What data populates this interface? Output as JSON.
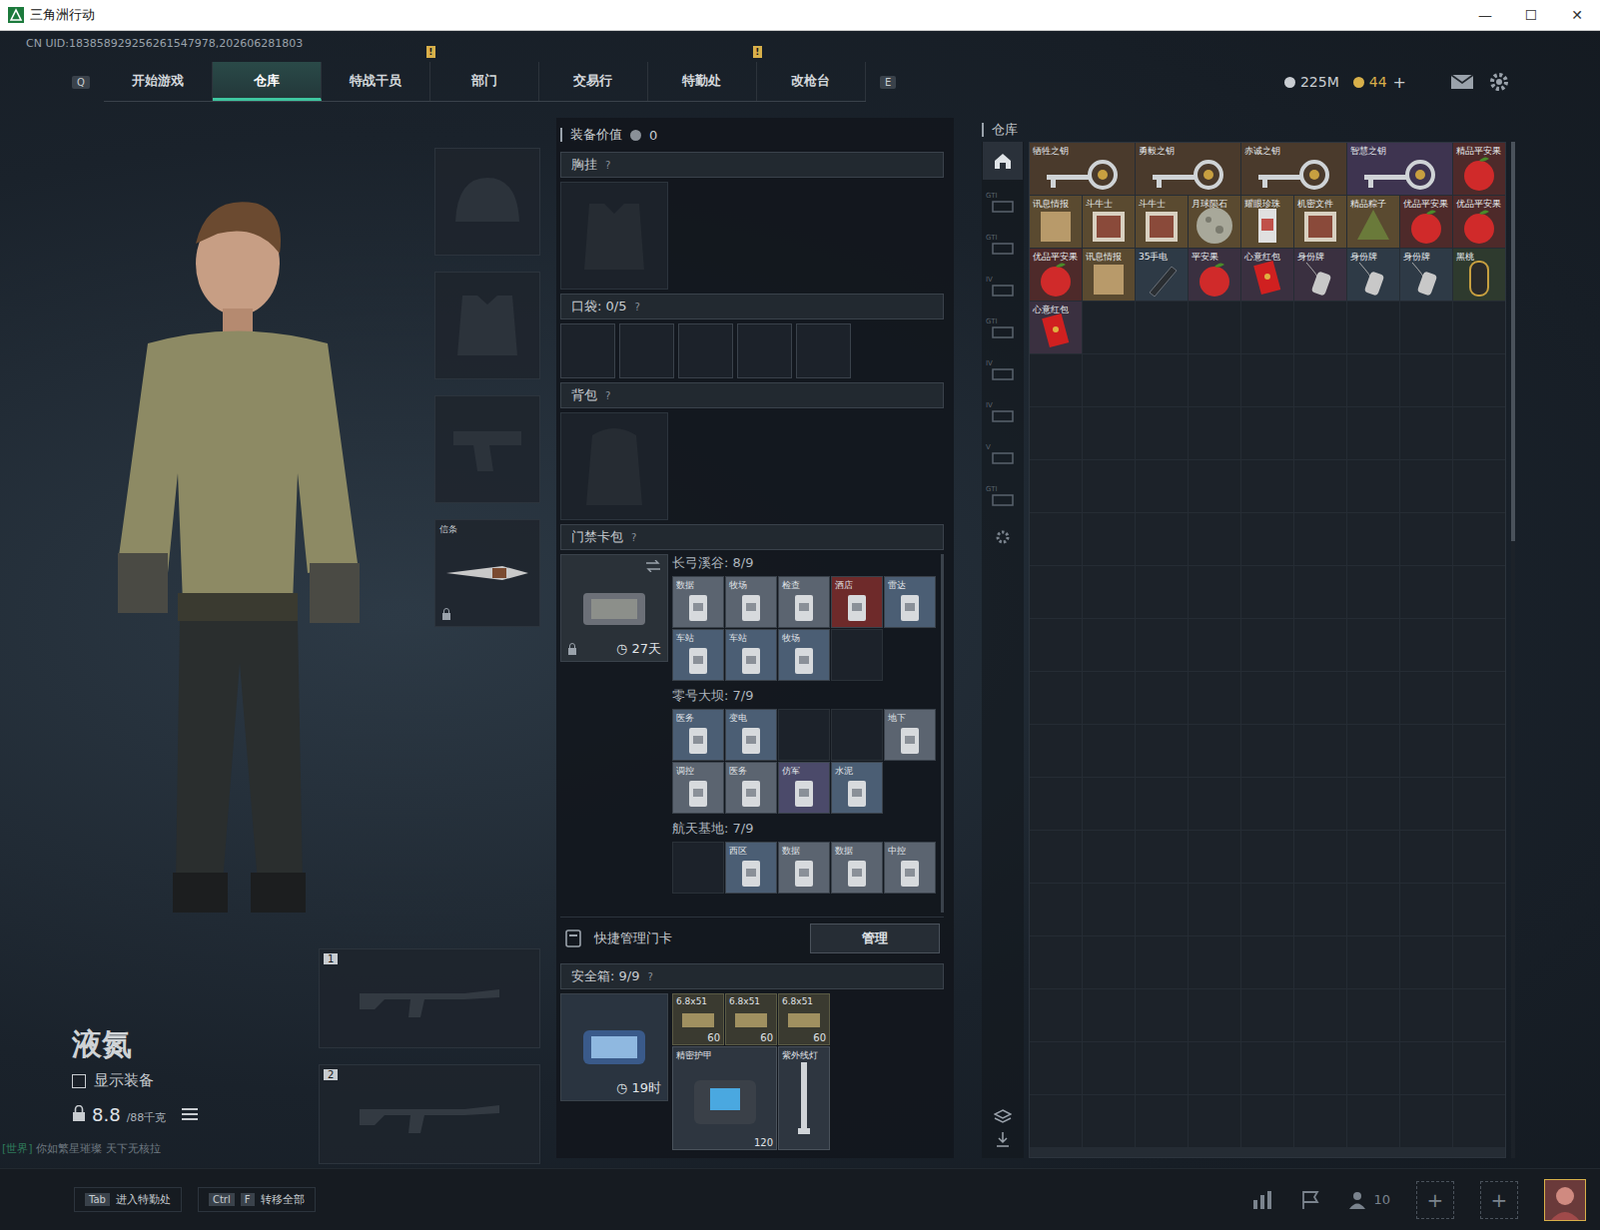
{
  "window": {
    "title": "三角洲行动",
    "controls": [
      "—",
      "☐",
      "✕"
    ]
  },
  "uid": "CN UID:183858929256261547978,202606281803",
  "nav": {
    "left_key": "Q",
    "right_key": "E",
    "badge_text": "!",
    "tabs": [
      {
        "label": "开始游戏",
        "selected": false,
        "badge": false
      },
      {
        "label": "仓库",
        "selected": true,
        "badge": false
      },
      {
        "label": "特战干员",
        "selected": false,
        "badge": true
      },
      {
        "label": "部门",
        "selected": false,
        "badge": false
      },
      {
        "label": "交易行",
        "selected": false,
        "badge": false
      },
      {
        "label": "特勤处",
        "selected": false,
        "badge": true
      },
      {
        "label": "改枪台",
        "selected": false,
        "badge": false
      }
    ]
  },
  "currency": [
    {
      "value": "225M",
      "color": "#c9cdd2"
    },
    {
      "value": "44",
      "color": "#d8b04a"
    }
  ],
  "currency_add": "+",
  "character": {
    "name": "液氮",
    "show_equipment": {
      "label": "显示装备",
      "checked": false
    },
    "weight": "8.8",
    "weight_max": "/88千克",
    "chat_channel": "[世界]",
    "chat_text": "你如繁星璀璨 天下无核拉"
  },
  "slots": [
    {
      "kind": "helmet",
      "label": "",
      "locked": false
    },
    {
      "kind": "armor",
      "label": "",
      "locked": false
    },
    {
      "kind": "pistol",
      "label": "",
      "locked": false
    },
    {
      "kind": "knife",
      "label": "信条",
      "locked": true
    }
  ],
  "weapons": [
    {
      "label": "1"
    },
    {
      "label": "2"
    }
  ],
  "loadout": {
    "value_label": "装备价值",
    "value": "0",
    "help": "?",
    "chest": "胸挂",
    "pockets_label": "口袋:",
    "pockets_count": "0/5",
    "pocket_slots": 5,
    "backpack": "背包",
    "card_pack": "门禁卡包",
    "card_timer": "27天",
    "maps": [
      {
        "name": "长弓溪谷: 8/9",
        "cards": [
          {
            "label": "数据",
            "empty": false,
            "color": "#5b6470"
          },
          {
            "label": "牧场",
            "empty": false,
            "color": "#5b6470"
          },
          {
            "label": "检查",
            "empty": false,
            "color": "#5b6470"
          },
          {
            "label": "酒店",
            "empty": false,
            "color": "#6e2a2a"
          },
          {
            "label": "雷达",
            "empty": false,
            "color": "#4b5e74"
          },
          {
            "label": "车站",
            "empty": false,
            "color": "#4b5e74"
          },
          {
            "label": "车站",
            "empty": false,
            "color": "#4b5e74"
          },
          {
            "label": "牧场",
            "empty": false,
            "color": "#4b5e74"
          },
          {
            "label": "",
            "empty": true,
            "color": "#1c222a"
          }
        ]
      },
      {
        "name": "零号大坝: 7/9",
        "cards": [
          {
            "label": "医务",
            "empty": false,
            "color": "#4b5e74"
          },
          {
            "label": "变电",
            "empty": false,
            "color": "#4b5e74"
          },
          {
            "label": "",
            "empty": true,
            "color": "#1c222a"
          },
          {
            "label": "",
            "empty": true,
            "color": "#1c222a"
          },
          {
            "label": "地下",
            "empty": false,
            "color": "#5b6470"
          },
          {
            "label": "调控",
            "empty": false,
            "color": "#5b6470"
          },
          {
            "label": "医务",
            "empty": false,
            "color": "#5b6470"
          },
          {
            "label": "仿军",
            "empty": false,
            "color": "#4b4a6a"
          },
          {
            "label": "水泥",
            "empty": false,
            "color": "#4b5e74"
          }
        ]
      },
      {
        "name": "航天基地: 7/9",
        "cards": [
          {
            "label": "",
            "empty": true,
            "color": "#1c222a"
          },
          {
            "label": "西区",
            "empty": false,
            "color": "#4b5e74"
          },
          {
            "label": "数据",
            "empty": false,
            "color": "#5b6470"
          },
          {
            "label": "数据",
            "empty": false,
            "color": "#5b6470"
          },
          {
            "label": "中控",
            "empty": false,
            "color": "#5b6470"
          }
        ]
      }
    ],
    "quick_manage": "快捷管理门卡",
    "manage_button": "管理",
    "safe_label": "安全箱:",
    "safe_count": "9/9",
    "safe_timer": "19时",
    "safe_items": [
      {
        "kind": "ammo",
        "label": "6.8x51",
        "count": "60"
      },
      {
        "kind": "ammo",
        "label": "6.8x51",
        "count": "60"
      },
      {
        "kind": "ammo",
        "label": "6.8x51",
        "count": "60"
      },
      {
        "kind": "bag",
        "label": "精密护甲",
        "count": "120"
      },
      {
        "kind": "lamp",
        "label": "紫外线灯",
        "count": ""
      }
    ]
  },
  "warehouse": {
    "title": "仓库",
    "tabs": [
      {
        "tag": "",
        "selected": true
      },
      {
        "tag": "GTI",
        "selected": false
      },
      {
        "tag": "GTI",
        "selected": false
      },
      {
        "tag": "IV",
        "selected": false
      },
      {
        "tag": "GTI",
        "selected": false
      },
      {
        "tag": "IV",
        "selected": false
      },
      {
        "tag": "IV",
        "selected": false
      },
      {
        "tag": "V",
        "selected": false
      },
      {
        "tag": "GTI",
        "selected": false
      }
    ],
    "items": [
      {
        "label": "牺牲之钥",
        "kind": "key",
        "color": "#4a3a2c"
      },
      {
        "label": "勇毅之钥",
        "kind": "key",
        "color": "#4a3a2c"
      },
      {
        "label": "赤诚之钥",
        "kind": "key",
        "color": "#4a3a2c"
      },
      {
        "label": "智慧之钥",
        "kind": "key",
        "color": "#3e3450"
      },
      {
        "label": "精品平安果",
        "kind": "fruit",
        "color": "#4e2a2a"
      },
      {
        "label": "讯息情报",
        "kind": "paper",
        "color": "#5a4a30"
      },
      {
        "label": "斗牛士",
        "kind": "picture",
        "color": "#5a4a30"
      },
      {
        "label": "斗牛士",
        "kind": "picture",
        "color": "#5a4a30"
      },
      {
        "label": "月球陨石",
        "kind": "orb",
        "color": "#5a4a30"
      },
      {
        "label": "耀眼珍珠",
        "kind": "vial",
        "color": "#5a4a30"
      },
      {
        "label": "机密文件",
        "kind": "picture",
        "color": "#5a4a30"
      },
      {
        "label": "精品粽子",
        "kind": "zongzi",
        "color": "#5a4a30"
      },
      {
        "label": "优品平安果",
        "kind": "fruit",
        "color": "#4e2a2a"
      },
      {
        "label": "优品平安果",
        "kind": "fruit",
        "color": "#4e2a2a"
      },
      {
        "label": "优品平安果",
        "kind": "fruit",
        "color": "#4e2a2a"
      },
      {
        "label": "讯息情报",
        "kind": "paper",
        "color": "#5a4a30"
      },
      {
        "label": "35手电",
        "kind": "torch",
        "color": "#2e3a46"
      },
      {
        "label": "平安果",
        "kind": "fruit",
        "color": "#3a3040"
      },
      {
        "label": "心意红包",
        "kind": "redpacket",
        "color": "#3a3040"
      },
      {
        "label": "身份牌",
        "kind": "tag",
        "color": "#3a3040"
      },
      {
        "label": "身份牌",
        "kind": "tag",
        "color": "#2e3a46"
      },
      {
        "label": "身份牌",
        "kind": "tag",
        "color": "#2e3a46"
      },
      {
        "label": "黑桃",
        "kind": "amulet",
        "color": "#2e3a2e"
      },
      {
        "label": "心意红包",
        "kind": "redpacket",
        "color": "#3a3040"
      }
    ]
  },
  "bottom": {
    "hints": [
      {
        "keys": [
          "Tab"
        ],
        "label": "进入特勤处"
      },
      {
        "keys": [
          "Ctrl",
          "F"
        ],
        "label": "转移全部"
      }
    ],
    "friends": "10",
    "slot_add": "+"
  }
}
